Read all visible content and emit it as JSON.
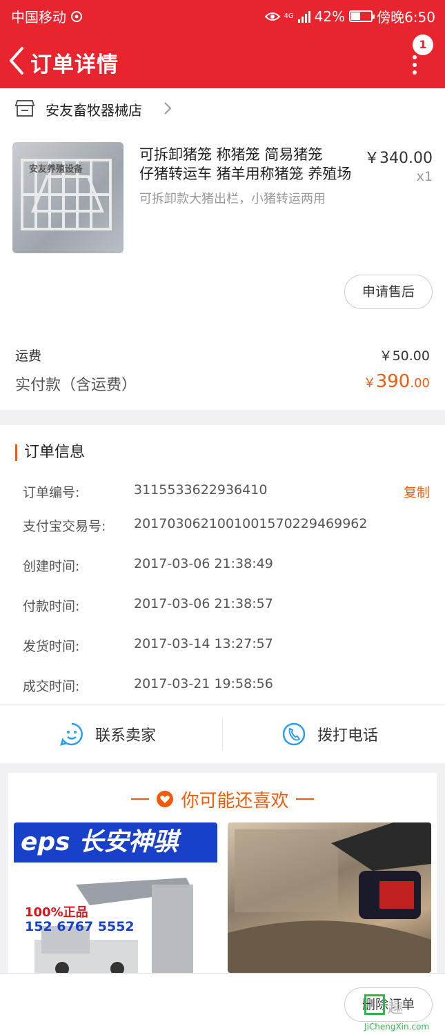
{
  "status_bar": {
    "carrier": "中国移动",
    "network": "4G",
    "battery": "42%",
    "time": "傍晚6:50"
  },
  "navbar": {
    "title": "订单详情",
    "badge_count": "1"
  },
  "order": {
    "shop_name": "安友畜牧器械店",
    "product_image_text": "安友养殖设备",
    "product_title_line1": "可拆卸猪笼 称猪笼 简易猪笼",
    "product_title_line2": "仔猪转运车 猪羊用称猪笼 养殖场",
    "product_subtitle": "可拆卸款大猪出栏，小猪转运两用",
    "product_price": "￥340.00",
    "product_qty": "x1",
    "aftersale_label": "申请售后",
    "freight_label": "运费",
    "freight_value": "￥50.00",
    "paid_label": "实付款（含运费）",
    "paid_currency": "￥",
    "paid_integer": "390",
    "paid_decimal": ".00"
  },
  "order_info": {
    "title": "订单信息",
    "copy_label": "复制",
    "rows": [
      {
        "label": "订单编号:",
        "value": "3115533622936410"
      },
      {
        "label": "支付宝交易号:",
        "value": "2017030621001001570229469962"
      },
      {
        "label": "创建时间:",
        "value": "2017-03-06 21:38:49"
      },
      {
        "label": "付款时间:",
        "value": "2017-03-06 21:38:57"
      },
      {
        "label": "发货时间:",
        "value": "2017-03-14 13:27:57"
      },
      {
        "label": "成交时间:",
        "value": "2017-03-21 19:58:56"
      }
    ],
    "contact_seller": "联系卖家",
    "call_phone": "拨打电话"
  },
  "recommend": {
    "title": "你可能还喜欢",
    "item1_banner": "eps 长安神骐",
    "item1_note": "100%正品",
    "item1_phone": "152 6767 5552"
  },
  "bottom": {
    "delete_label": "删除订单"
  },
  "watermark": {
    "text": "趣",
    "url": "JiChengXin.com"
  },
  "colors": {
    "header": "#e8242f",
    "accent": "#f05a0a"
  }
}
